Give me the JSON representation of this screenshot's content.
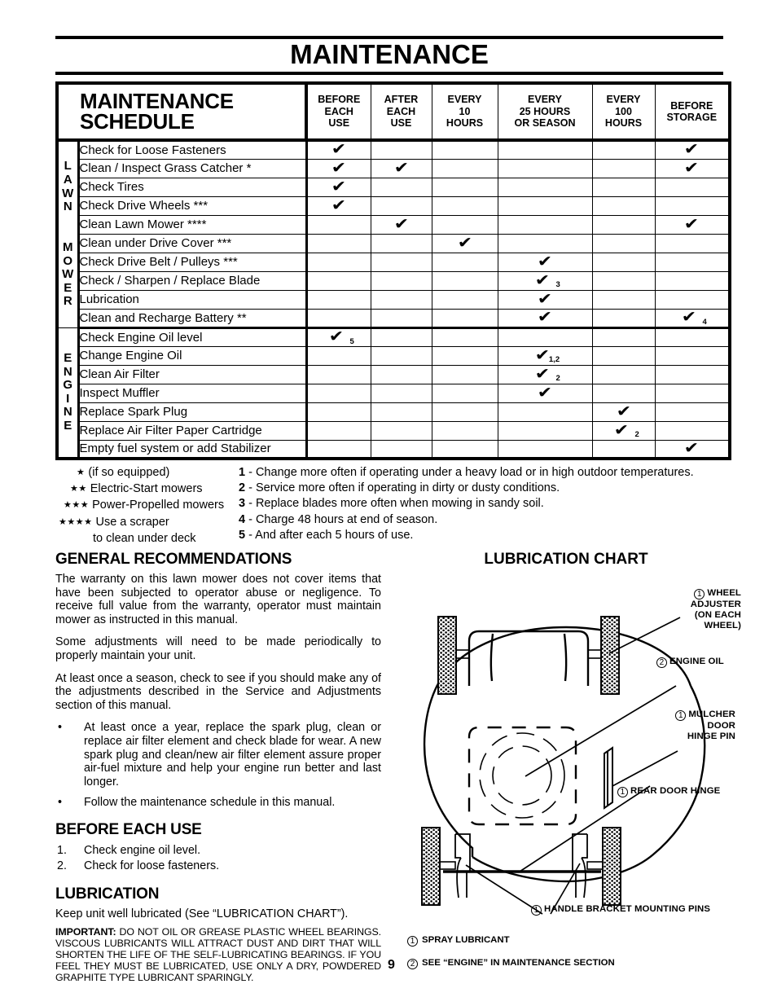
{
  "page": {
    "title": "MAINTENANCE",
    "number": "9"
  },
  "schedule": {
    "title_line1": "MAINTENANCE",
    "title_line2": "SCHEDULE",
    "columns": [
      "BEFORE\nEACH\nUSE",
      "AFTER\nEACH\nUSE",
      "EVERY\n10\nHOURS",
      "EVERY\n25 HOURS\nOR SEASON",
      "EVERY\n100\nHOURS",
      "BEFORE\nSTORAGE"
    ],
    "groups": [
      {
        "label": "LAWN MOWER",
        "rows": [
          {
            "task": "Check for Loose Fasteners",
            "marks": [
              "1",
              "",
              "",
              "",
              "",
              "1"
            ]
          },
          {
            "task": "Clean / Inspect Grass Catcher *",
            "marks": [
              "1",
              "1",
              "",
              "",
              "",
              "1"
            ]
          },
          {
            "task": "Check Tires",
            "marks": [
              "1",
              "",
              "",
              "",
              "",
              ""
            ]
          },
          {
            "task": "Check Drive Wheels ***",
            "marks": [
              "1",
              "",
              "",
              "",
              "",
              ""
            ]
          },
          {
            "task": "Clean Lawn Mower ****",
            "marks": [
              "",
              "1",
              "",
              "",
              "",
              "1"
            ]
          },
          {
            "task": "Clean under Drive Cover ***",
            "marks": [
              "",
              "",
              "1",
              "",
              "",
              ""
            ]
          },
          {
            "task": "Check Drive Belt / Pulleys ***",
            "marks": [
              "",
              "",
              "",
              "1",
              "",
              ""
            ]
          },
          {
            "task": "Check / Sharpen / Replace Blade",
            "marks": [
              "",
              "",
              "",
              "1:3",
              "",
              ""
            ]
          },
          {
            "task": "Lubrication",
            "marks": [
              "",
              "",
              "",
              "1",
              "",
              ""
            ]
          },
          {
            "task": "Clean and Recharge Battery **",
            "marks": [
              "",
              "",
              "",
              "1",
              "",
              "1:4"
            ]
          }
        ]
      },
      {
        "label": "ENGINE",
        "rows": [
          {
            "task": "Check Engine Oil level",
            "marks": [
              "1:5",
              "",
              "",
              "",
              "",
              ""
            ]
          },
          {
            "task": "Change Engine Oil",
            "marks": [
              "",
              "",
              "",
              "1:1,2",
              "",
              ""
            ]
          },
          {
            "task": "Clean Air Filter",
            "marks": [
              "",
              "",
              "",
              "1:2",
              "",
              ""
            ]
          },
          {
            "task": "Inspect Muffler",
            "marks": [
              "",
              "",
              "",
              "1",
              "",
              ""
            ]
          },
          {
            "task": "Replace Spark Plug",
            "marks": [
              "",
              "",
              "",
              "",
              "1",
              ""
            ]
          },
          {
            "task": "Replace Air Filter Paper Cartridge",
            "marks": [
              "",
              "",
              "",
              "",
              "1:2",
              ""
            ]
          },
          {
            "task": "Empty fuel system or add Stabilizer",
            "marks": [
              "",
              "",
              "",
              "",
              "",
              "1"
            ]
          }
        ]
      }
    ]
  },
  "footnotes_left": [
    {
      "stars": "★",
      "text": "(if so equipped)",
      "cont": ""
    },
    {
      "stars": "★★",
      "text": "Electric-Start mowers",
      "cont": ""
    },
    {
      "stars": "★★★",
      "text": "Power-Propelled mowers",
      "cont": ""
    },
    {
      "stars": "★★★★",
      "text": "Use a scraper",
      "cont": "to clean under deck"
    }
  ],
  "footnotes_right": [
    {
      "num": "1",
      "text": " - Change more often if operating under a heavy load or in high outdoor temperatures."
    },
    {
      "num": "2",
      "text": " - Service more often if operating in dirty or dusty conditions."
    },
    {
      "num": "3",
      "text": " - Replace blades more often when mowing in sandy soil."
    },
    {
      "num": "4",
      "text": " - Charge 48 hours at end of season."
    },
    {
      "num": "5",
      "text": " - And after each 5 hours of use."
    }
  ],
  "general": {
    "heading": "GENERAL RECOMMENDATIONS",
    "paragraphs": [
      "The warranty on this lawn mower does not cover items that have been subjected to operator abuse or negligence.  To receive full value from the warranty, operator must maintain mower as instructed in this manual.",
      "Some adjustments will need to be made periodically to properly maintain your unit.",
      "At least once a season, check to see if you should make any of the adjustments described in the Service and Adjustments section of this manual."
    ],
    "bullets": [
      "At least once a year, replace the spark plug, clean or replace air filter element and check blade for wear.  A new spark plug and clean/new air filter element assure proper air-fuel mixture and help your engine run better and last longer.",
      "Follow the maintenance schedule in this manual."
    ]
  },
  "before_each_use": {
    "heading": "BEFORE EACH USE",
    "items": [
      {
        "num": "1.",
        "text": "Check engine oil level."
      },
      {
        "num": "2.",
        "text": "Check for loose fasteners."
      }
    ]
  },
  "lubrication": {
    "heading": "LUBRICATION",
    "intro": "Keep unit well lubricated (See “LUBRICATION CHART”).",
    "important_label": "IMPORTANT:",
    "important_text": "  DO NOT OIL OR GREASE PLASTIC WHEEL BEARINGS.  VISCOUS LUBRICANTS WILL ATTRACT DUST AND DIRT THAT WILL SHORTEN THE LIFE OF THE SELF-LUBRICATING BEARINGS.  IF YOU FEEL THEY MUST BE LUBRICATED, USE ONLY A DRY, POWDERED GRAPHITE TYPE LUBRICANT SPARINGLY."
  },
  "lubrication_chart": {
    "title": "LUBRICATION CHART",
    "callouts": [
      {
        "marker": "1",
        "lines": [
          "WHEEL",
          "ADJUSTER",
          "(ON EACH",
          "WHEEL)"
        ],
        "align": "right"
      },
      {
        "marker": "2",
        "lines": [
          "ENGINE OIL"
        ],
        "align": "left"
      },
      {
        "marker": "1",
        "lines": [
          "MULCHER",
          "DOOR",
          "HINGE PIN"
        ],
        "align": "right"
      },
      {
        "marker": "1",
        "lines": [
          "REAR DOOR HINGE"
        ],
        "align": "left"
      },
      {
        "marker": "1",
        "lines": [
          "HANDLE BRACKET MOUNTING PINS"
        ],
        "align": "left"
      }
    ],
    "legend": [
      {
        "marker": "1",
        "text": "SPRAY LUBRICANT"
      },
      {
        "marker": "2",
        "text": "SEE “ENGINE” IN MAINTENANCE SECTION"
      }
    ]
  }
}
